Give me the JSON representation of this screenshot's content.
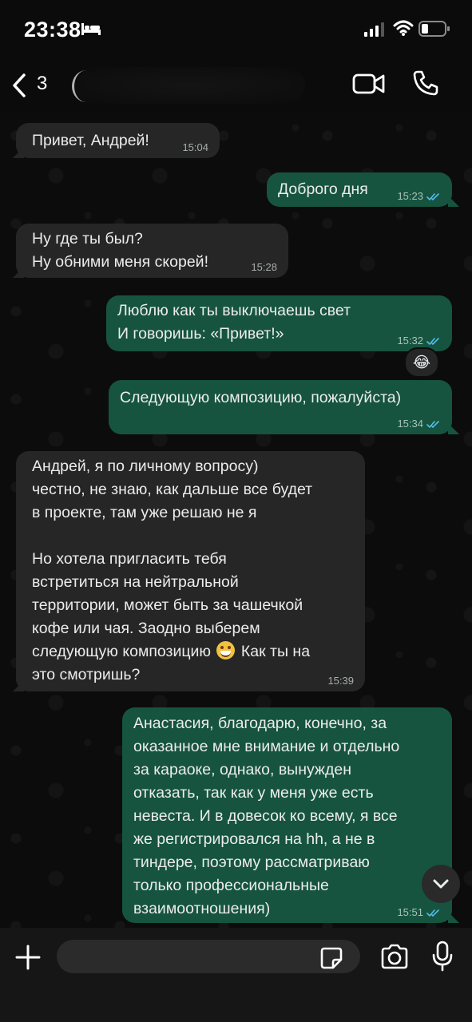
{
  "status_bar": {
    "time": "23:38"
  },
  "header": {
    "unread_count": "3",
    "contact_name": ""
  },
  "messages": [
    {
      "dir": "in",
      "text": "Привет, Андрей!",
      "time": "15:04"
    },
    {
      "dir": "out",
      "text": "Доброго дня",
      "time": "15:23",
      "read": true
    },
    {
      "dir": "in",
      "text": "Ну где ты был?\nНу обними меня скорей!",
      "time": "15:28"
    },
    {
      "dir": "out",
      "text": "Люблю как ты выключаешь свет\nИ говоришь: «Привет!»",
      "time": "15:32",
      "read": true,
      "reaction": "😂"
    },
    {
      "dir": "out",
      "text": "Следующую композицию, пожалуйста)",
      "time": "15:34",
      "read": true
    },
    {
      "dir": "in",
      "text_part1": "Андрей, я по личному вопросу)\nчестно, не знаю, как дальше все будет\nв проекте, там уже решаю не я\n\nНо хотела пригласить тебя\nвстретиться на нейтральной\nтерритории, может быть за чашечкой\nкофе или чая. Заодно выберем\nследующую композицию",
      "emoji": "😄",
      "text_part2": " Как ты на\nэто смотришь?",
      "time": "15:39"
    },
    {
      "dir": "out",
      "text": "Анастасия, благодарю, конечно, за\nоказанное мне внимание и отдельно\nза караоке, однако, вынужден\nотказать, так как у меня уже есть\nневеста. И в довесок ко всему, я все\nже регистрировался на hh, а не в\nтиндере, поэтому рассматриваю\nтолько профессиональные\nвзаимоотношения)",
      "time": "15:51",
      "read": true
    }
  ],
  "composer": {
    "input_value": ""
  },
  "colors": {
    "incoming_bubble": "#262626",
    "outgoing_bubble": "#165440",
    "read_ticks": "#53bdeb"
  },
  "icons": [
    "bed-icon",
    "signal-icon",
    "wifi-icon",
    "battery-icon",
    "back-icon",
    "video-call-icon",
    "phone-call-icon",
    "scroll-down-icon",
    "plus-icon",
    "sticker-icon",
    "camera-icon",
    "microphone-icon"
  ]
}
